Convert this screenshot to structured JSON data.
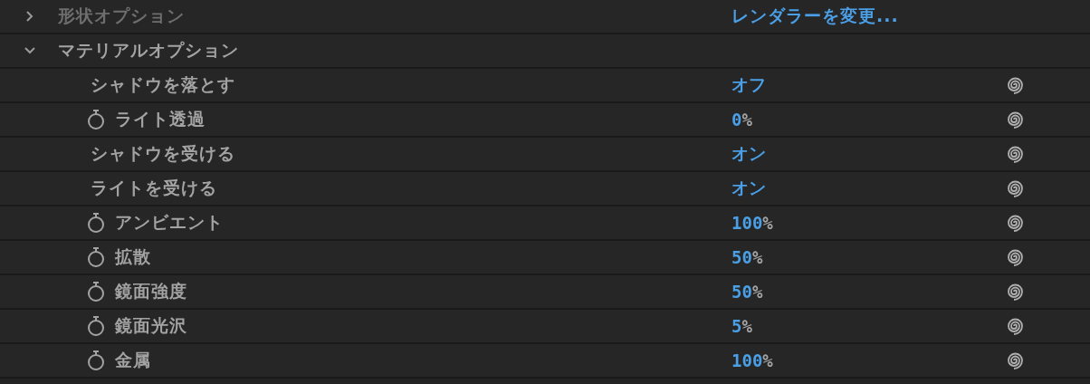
{
  "groups": [
    {
      "label": "形状オプション",
      "expanded": false,
      "disabled": true,
      "action": "レンダラーを変更..."
    },
    {
      "label": "マテリアルオプション",
      "expanded": true,
      "disabled": false,
      "properties": [
        {
          "label": "シャドウを落とす",
          "kind": "plain",
          "value": "オフ"
        },
        {
          "label": "ライト透過",
          "kind": "stopwatch",
          "value": "0",
          "unit": "%"
        },
        {
          "label": "シャドウを受ける",
          "kind": "plain",
          "value": "オン"
        },
        {
          "label": "ライトを受ける",
          "kind": "plain",
          "value": "オン"
        },
        {
          "label": "アンビエント",
          "kind": "stopwatch",
          "value": "100",
          "unit": "%"
        },
        {
          "label": "拡散",
          "kind": "stopwatch",
          "value": "50",
          "unit": "%"
        },
        {
          "label": "鏡面強度",
          "kind": "stopwatch",
          "value": "50",
          "unit": "%"
        },
        {
          "label": "鏡面光沢",
          "kind": "stopwatch",
          "value": "5",
          "unit": "%"
        },
        {
          "label": "金属",
          "kind": "stopwatch",
          "value": "100",
          "unit": "%"
        }
      ]
    }
  ]
}
